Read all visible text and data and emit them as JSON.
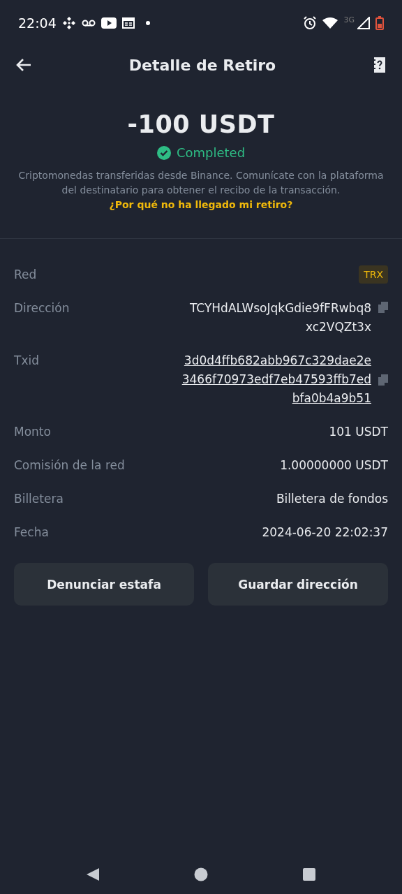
{
  "status_bar": {
    "time": "22:04",
    "network": "3G"
  },
  "header": {
    "title": "Detalle de Retiro"
  },
  "summary": {
    "amount": "-100 USDT",
    "status": "Completed",
    "note": "Criptomonedas transferidas desde Binance. Comunícate con la plataforma del destinatario para obtener el recibo de la transacción.",
    "link": "¿Por qué no ha llegado mi retiro?"
  },
  "details": [
    {
      "kind": "badge",
      "label": "Red",
      "lines": [
        "TRX"
      ]
    },
    {
      "kind": "copy",
      "label": "Dirección",
      "lines": [
        "TCYHdALWsoJqkGdie9fFRwbq8",
        "xc2VQZt3x"
      ]
    },
    {
      "kind": "link",
      "label": "Txid",
      "lines": [
        "3d0d4ffb682abb967c329dae2e",
        "3466f70973edf7eb47593ffb7ed",
        "bfa0b4a9b51"
      ]
    },
    {
      "kind": "text",
      "label": "Monto",
      "lines": [
        "101 USDT"
      ]
    },
    {
      "kind": "text",
      "label": "Comisión de la red",
      "lines": [
        "1.00000000 USDT"
      ]
    },
    {
      "kind": "text",
      "label": "Billetera",
      "lines": [
        "Billetera de fondos"
      ]
    },
    {
      "kind": "text",
      "label": "Fecha",
      "lines": [
        "2024-06-20 22:02:37"
      ]
    }
  ],
  "buttons": [
    "Denunciar estafa",
    "Guardar dirección"
  ]
}
